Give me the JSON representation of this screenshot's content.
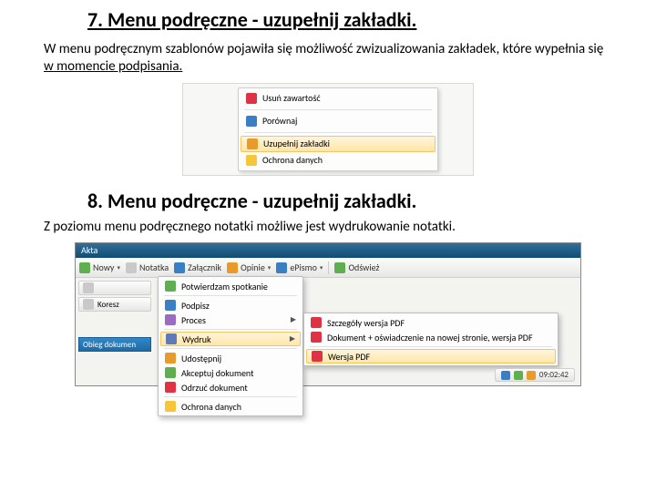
{
  "section7": {
    "title": "7. Menu podręczne - uzupełnij zakładki.",
    "body_plain": "W menu podręcznym szablonów pojawiła się możliwość zwizualizowania zakładek,  które wypełnia się ",
    "body_underlined": "w momencie podpisania."
  },
  "section8": {
    "title": "8. Menu podręczne - uzupełnij zakładki.",
    "body": "Z poziomu menu podręcznego notatki możliwe jest wydrukowanie notatki."
  },
  "menu1": {
    "items": [
      {
        "label": "Usuń zawartość",
        "icon": "red"
      },
      {
        "label": "Porównaj",
        "icon": "blue",
        "sep_before": true
      },
      {
        "label": "Uzupełnij zakładki",
        "icon": "orange",
        "selected": true,
        "sep_before": true
      },
      {
        "label": "Ochrona danych",
        "icon": "yellow"
      }
    ]
  },
  "app": {
    "title": "Akta",
    "toolbar": [
      {
        "label": "Nowy",
        "icon": "green",
        "dropdown": true
      },
      {
        "label": "Notatka",
        "icon": "gray"
      },
      {
        "label": "Załącznik",
        "icon": "blue"
      },
      {
        "label": "Opinie",
        "icon": "orange",
        "dropdown": true
      },
      {
        "label": "ePismo",
        "icon": "blue",
        "dropdown": true
      },
      {
        "label": "Odśwież",
        "icon": "green",
        "sep_before": true
      }
    ],
    "left": {
      "row1": "",
      "row2": "Koresz",
      "bluebar": "Obieg dokumen"
    },
    "context_menu": [
      {
        "label": "Potwierdzam spotkanie",
        "icon": "green"
      },
      {
        "label": "Podpisz",
        "icon": "blue",
        "sep_before": true
      },
      {
        "label": "Proces",
        "icon": "purple",
        "arrow": true
      },
      {
        "label": "Wydruk",
        "icon": "save",
        "arrow": true,
        "selected": true,
        "sep_before": true
      },
      {
        "label": "Udostępnij",
        "icon": "orange",
        "sep_before": true
      },
      {
        "label": "Akceptuj dokument",
        "icon": "green"
      },
      {
        "label": "Odrzuć dokument",
        "icon": "red"
      },
      {
        "label": "Ochrona danych",
        "icon": "yellow",
        "sep_before": true
      }
    ],
    "submenu": [
      {
        "label": "Szczegóły wersja PDF",
        "icon": "red"
      },
      {
        "label": "Dokument + oświadczenie na nowej stronie, wersja PDF",
        "icon": "red"
      },
      {
        "label": "Wersja PDF",
        "icon": "red",
        "selected": true,
        "sep_before": true
      }
    ],
    "tray": {
      "time": "09:02:42"
    }
  }
}
